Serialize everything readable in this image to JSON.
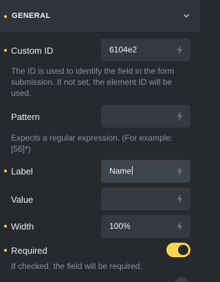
{
  "section": {
    "title": "GENERAL"
  },
  "fields": {
    "custom_id": {
      "label": "Custom ID",
      "value": "6104e2",
      "description": "The ID is used to identify the field in the form submission. If not set, the element ID will be used."
    },
    "pattern": {
      "label": "Pattern",
      "value": "",
      "description": "Expects a regular expression. (For example: [56]*)"
    },
    "label": {
      "label": "Label",
      "value": "Name"
    },
    "value": {
      "label": "Value",
      "value": ""
    },
    "width": {
      "label": "Width",
      "value": "100%"
    },
    "required": {
      "label": "Required",
      "checked": true,
      "description": "If checked, the field will be required."
    }
  },
  "icons": {
    "section_toggle": "chevron-down-icon",
    "dynamic_data": "bolt-icon"
  },
  "colors": {
    "accent": "#ffd64f",
    "background": "#262a2f",
    "input_background": "#353a41",
    "muted_text": "#8b9098"
  }
}
